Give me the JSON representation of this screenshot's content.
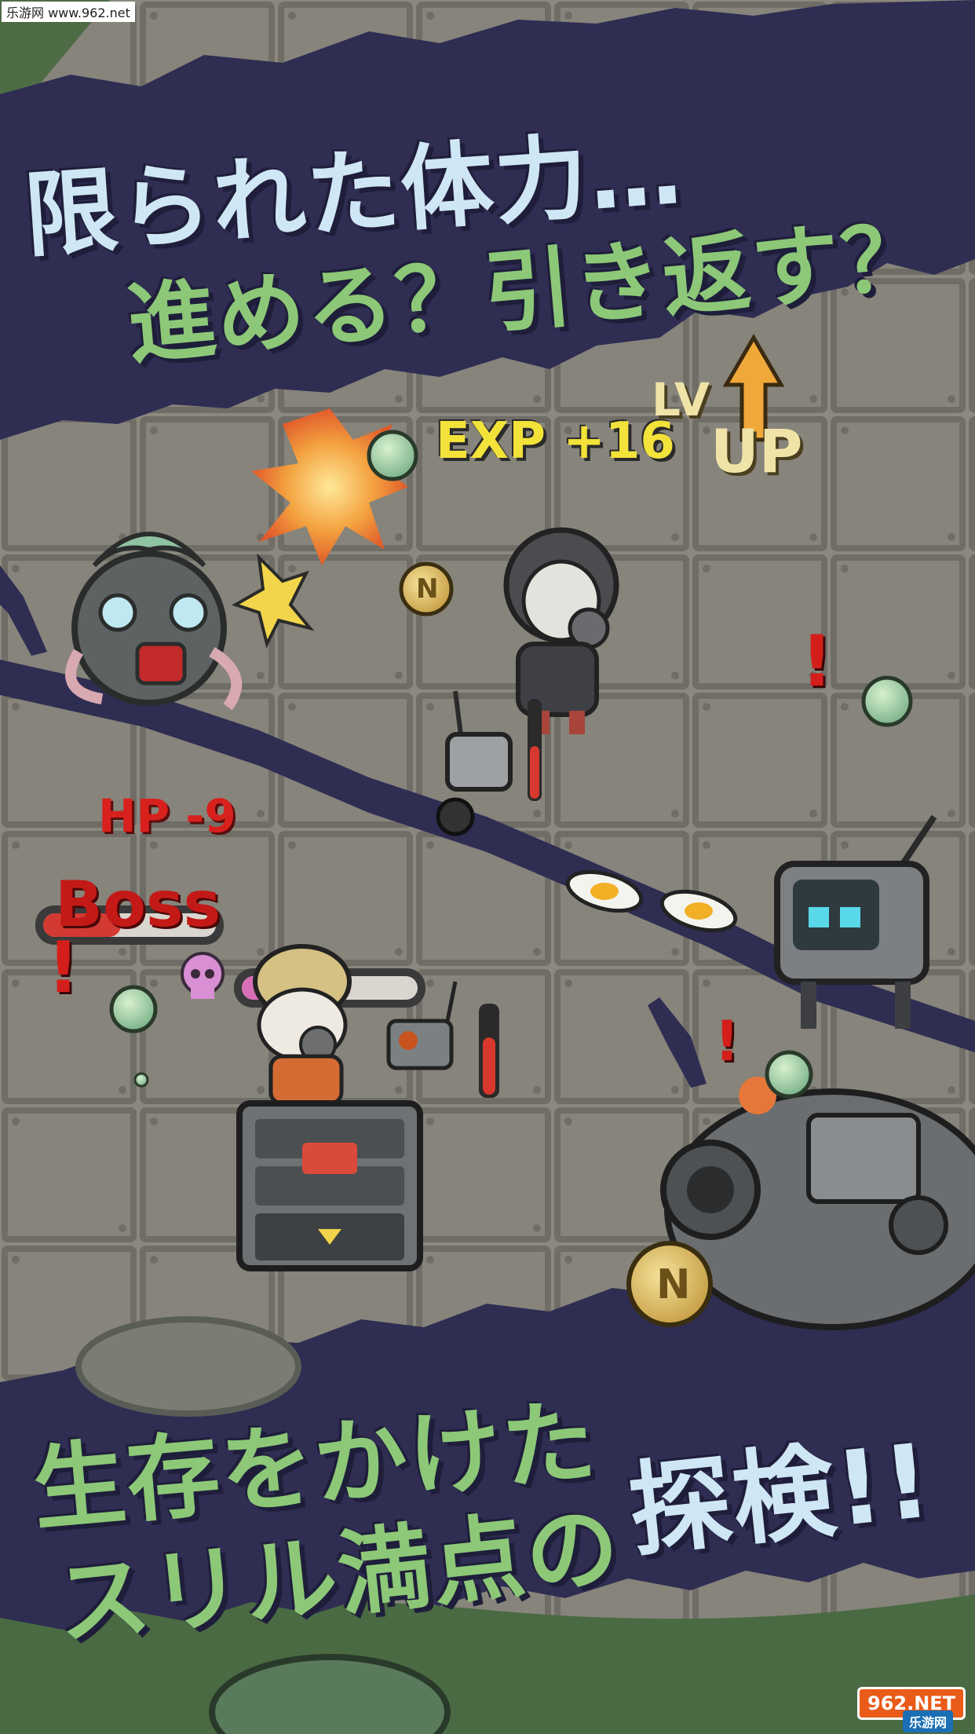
{
  "watermark_top": "乐游网 www.962.net",
  "headline_top": {
    "line1": "限られた体力…",
    "line2": "進める？引き返す？"
  },
  "game": {
    "exp_popup": "EXP +16",
    "level_up_top": "LV",
    "level_up_bottom": "UP",
    "hp_popup": "HP -9",
    "boss_label": "Boss",
    "alert_mark": "!",
    "coin_letter": "N",
    "enemy_hp_fraction": 0.45,
    "player_hp_fraction": 0.62,
    "companion_gauge_fraction": 0.65,
    "robot_gauge_fraction": 0.55
  },
  "headline_bottom": {
    "line1": "生存をかけた",
    "line2a": "スリル満点の",
    "line2b": "探検!!"
  },
  "logo": {
    "main": "962.NET",
    "sub": "乐游网"
  },
  "colors": {
    "banner": "#2f2d52",
    "floor": "#8a887f",
    "tile_line": "#6f6d66",
    "accent_green": "#8cc878",
    "accent_pale": "#cfe6f5",
    "exp_yellow": "#f2e23a",
    "damage_red": "#d8201d"
  }
}
